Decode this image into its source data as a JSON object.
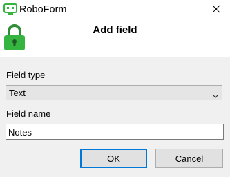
{
  "window": {
    "title": "RoboForm",
    "close_label": "×"
  },
  "dialog": {
    "heading": "Add field"
  },
  "form": {
    "field_type_label": "Field type",
    "field_type_value": "Text",
    "field_name_label": "Field name",
    "field_name_value": "Notes"
  },
  "buttons": {
    "ok_label": "OK",
    "cancel_label": "Cancel"
  },
  "colors": {
    "brand_green": "#35b540",
    "focus_blue": "#0078d7"
  },
  "icons": {
    "app": "roboform-logo-icon",
    "lock": "lock-icon",
    "close": "close-icon",
    "dropdown": "chevron-down-icon"
  }
}
